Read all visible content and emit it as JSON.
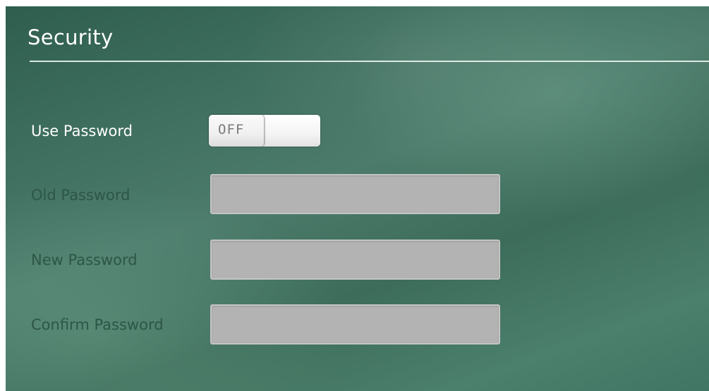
{
  "section": {
    "title": "Security"
  },
  "use_password": {
    "label": "Use Password",
    "toggle_state": "OFF"
  },
  "fields": {
    "old_password": {
      "label": "Old Password",
      "value": ""
    },
    "new_password": {
      "label": "New Password",
      "value": ""
    },
    "confirm_password": {
      "label": "Confirm Password",
      "value": ""
    }
  },
  "colors": {
    "background": "#3f6f5f",
    "disabled_label": "#2d5647",
    "field_fill": "#b3b3b3"
  }
}
